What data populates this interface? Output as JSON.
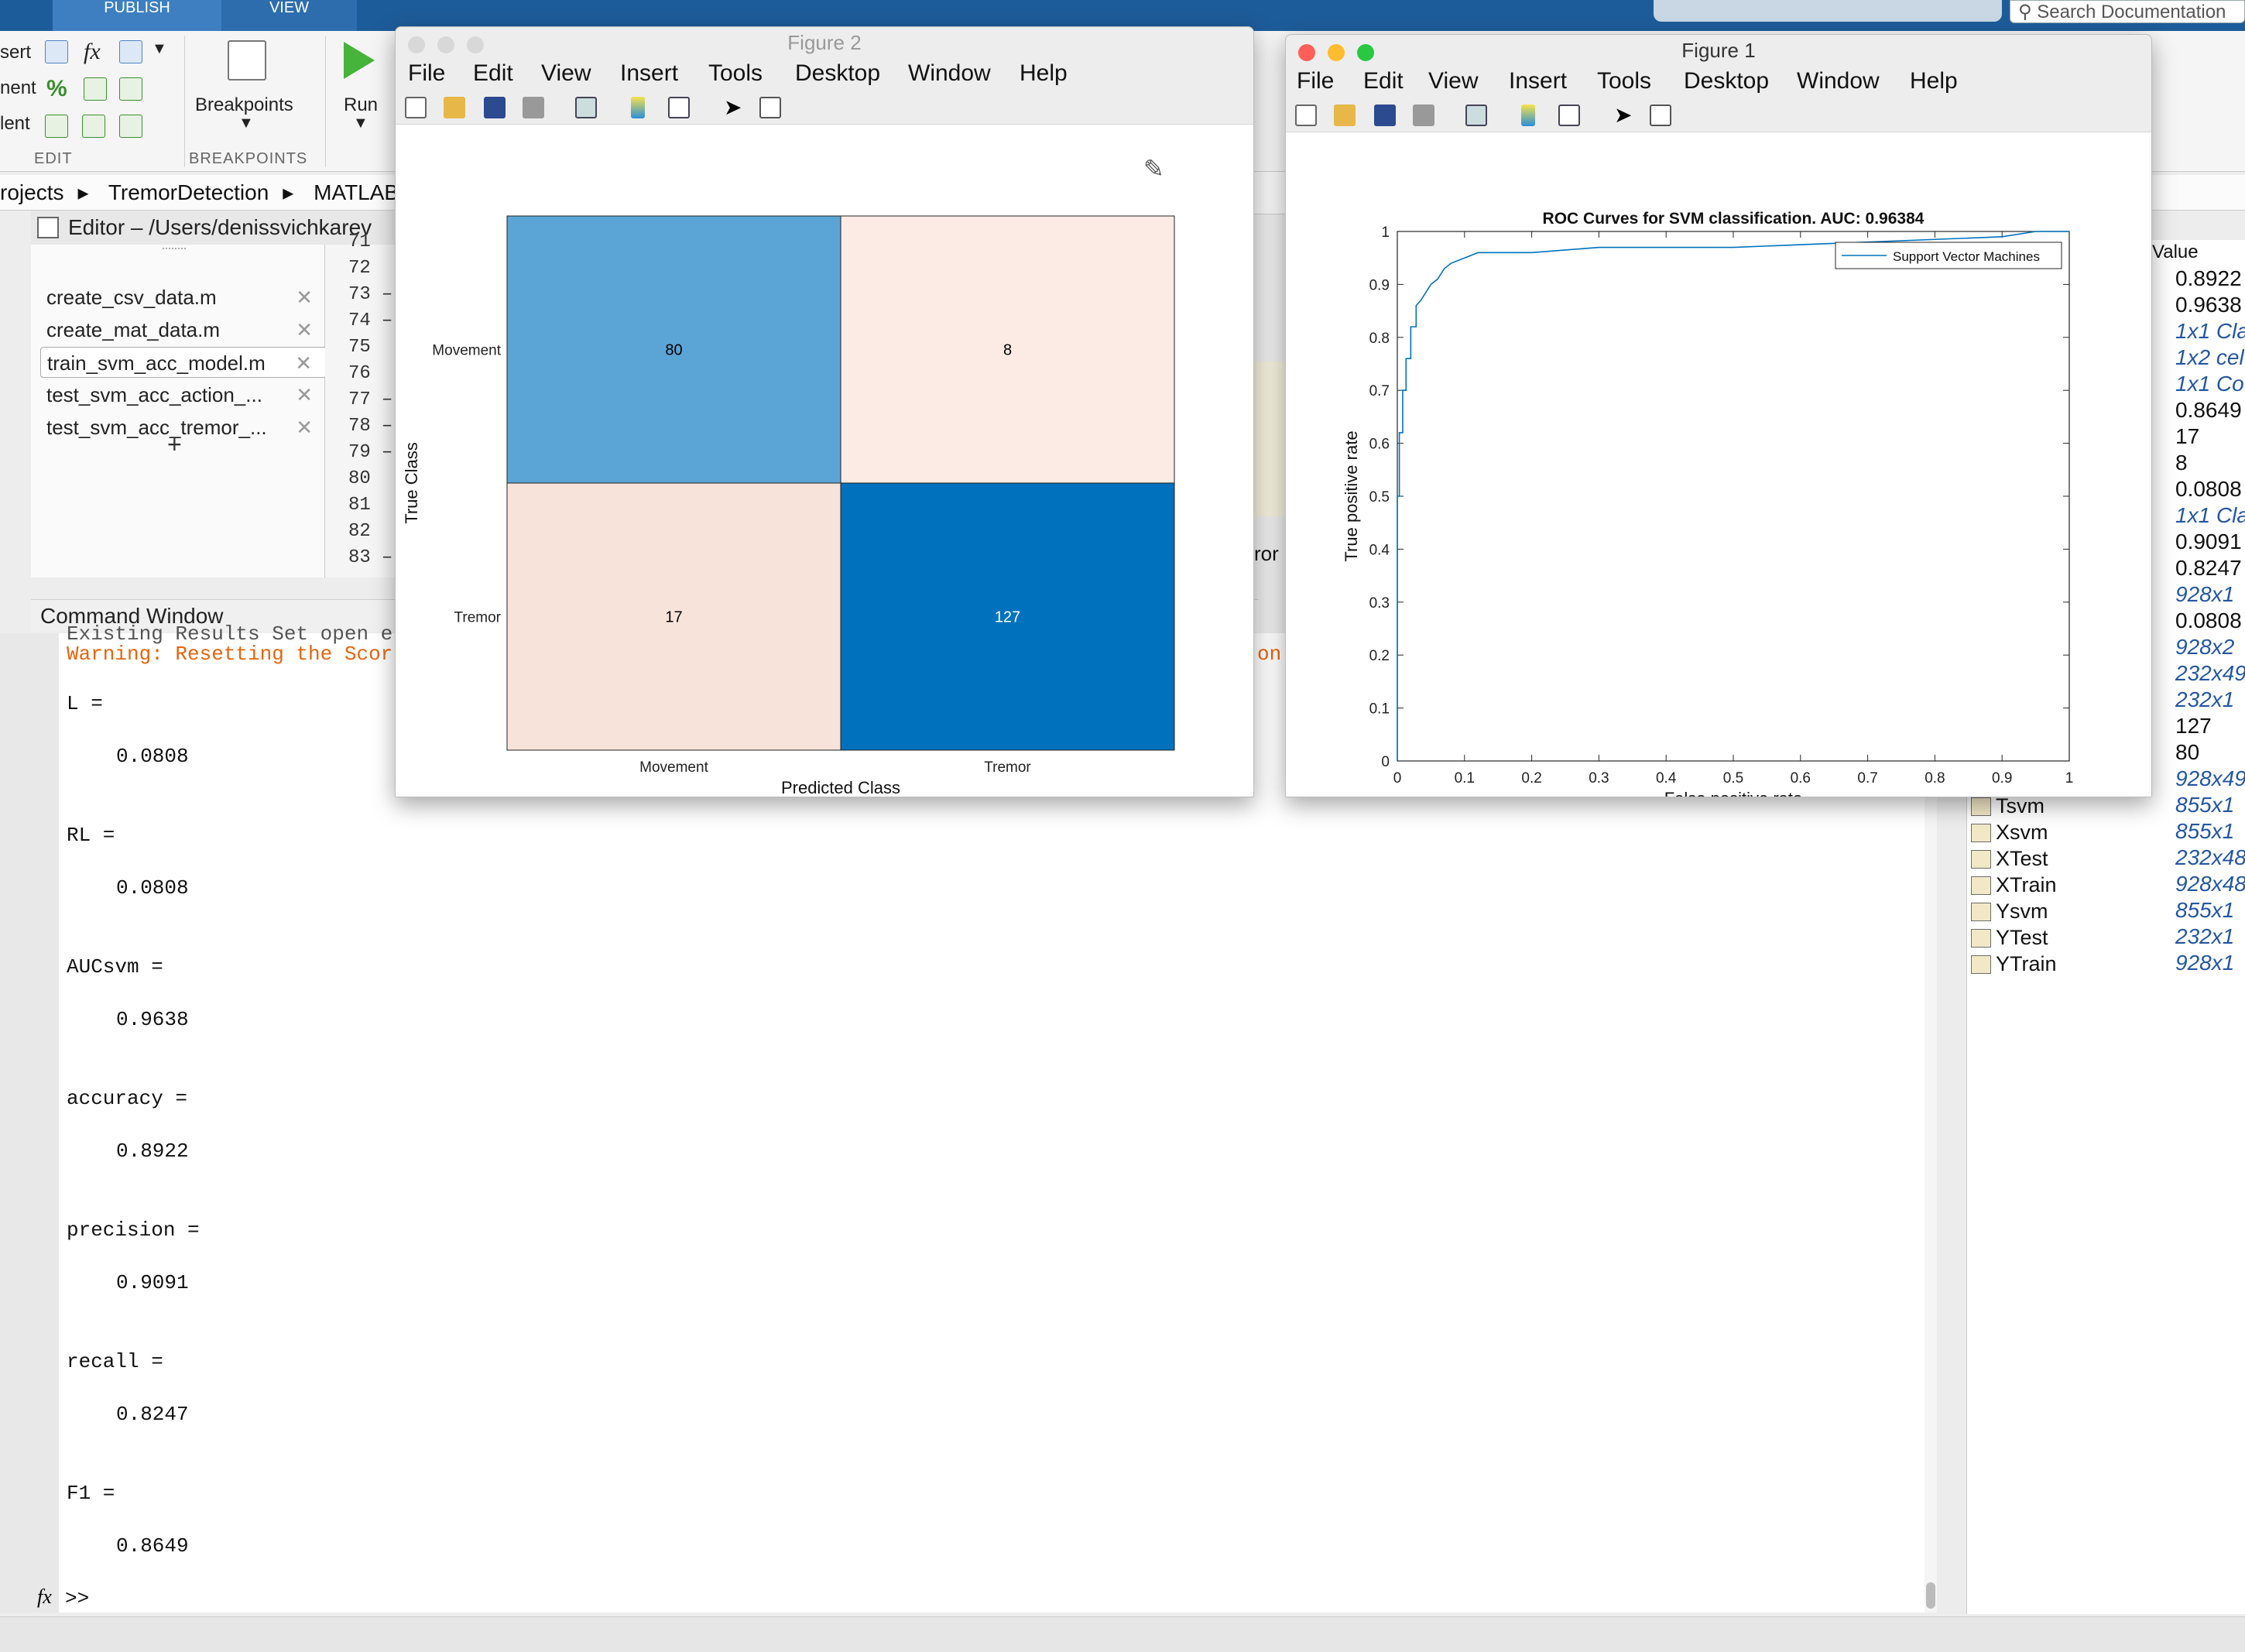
{
  "ribbon": {
    "tabs": [
      "PUBLISH",
      "VIEW"
    ],
    "search_placeholder": "Search Documentation",
    "edit_rows": [
      "sert",
      "nent",
      "lent"
    ],
    "fx_label": "fx",
    "percent_label": "%",
    "breakpoints_label": "Breakpoints",
    "run_label": "Run",
    "sections": [
      "EDIT",
      "BREAKPOINTS"
    ]
  },
  "breadcrumb": [
    "rojects",
    "TremorDetection",
    "MATLAB"
  ],
  "editor": {
    "title": "Editor – /Users/denissvichkarev",
    "files": [
      "create_csv_data.m",
      "create_mat_data.m",
      "train_svm_acc_model.m",
      "test_svm_acc_action_...",
      "test_svm_acc_tremor_..."
    ],
    "active_index": 2,
    "add_label": "+",
    "close_glyph": "✕",
    "line_numbers": [
      "71",
      "72",
      "73",
      "74",
      "75",
      "76",
      "77",
      "78",
      "79",
      "80",
      "81",
      "82",
      "83"
    ],
    "line_marks": [
      "",
      "",
      "–",
      "–",
      "",
      "",
      "–",
      "–",
      "–",
      "",
      "",
      "",
      "–"
    ],
    "code_fragment": "ror"
  },
  "command_window": {
    "title": "Command Window",
    "partial_line": "Existing Results Set open e",
    "warning": "Warning: Resetting the Scor",
    "warning_tail": "on.",
    "outputs": [
      {
        "name": "L =",
        "value": "0.0808"
      },
      {
        "name": "RL =",
        "value": "0.0808"
      },
      {
        "name": "AUCsvm =",
        "value": "0.9638"
      },
      {
        "name": "accuracy =",
        "value": "0.8922"
      },
      {
        "name": "precision =",
        "value": "0.9091"
      },
      {
        "name": "recall =",
        "value": "0.8247"
      },
      {
        "name": "F1 =",
        "value": "0.8649"
      }
    ],
    "prompt": ">>",
    "fx": "fx"
  },
  "workspace": {
    "header": "Value",
    "values": [
      "0.8922",
      "0.9638",
      "1x1 Cla",
      "1x2 cel",
      "1x1 Co",
      "0.8649",
      "17",
      "8",
      "0.0808",
      "1x1 Cla",
      "0.9091",
      "0.8247",
      "928x1",
      "0.0808",
      "928x2",
      "232x49",
      "232x1",
      "127",
      "80",
      "928x49",
      "855x1",
      "855x1",
      "232x48",
      "928x48",
      "855x1",
      "232x1",
      "928x1"
    ],
    "italic": [
      false,
      false,
      true,
      true,
      true,
      false,
      false,
      false,
      false,
      true,
      false,
      false,
      true,
      false,
      true,
      true,
      true,
      false,
      false,
      true,
      true,
      true,
      true,
      true,
      true,
      true,
      true
    ],
    "names": [
      "Tsvm",
      "Xsvm",
      "XTest",
      "XTrain",
      "Ysvm",
      "YTest",
      "YTrain"
    ]
  },
  "figure2": {
    "title": "Figure 2",
    "menu": [
      "File",
      "Edit",
      "View",
      "Insert",
      "Tools",
      "Desktop",
      "Window",
      "Help"
    ],
    "chart_data": {
      "type": "heatmap",
      "title": "",
      "xlabel": "Predicted Class",
      "ylabel": "True Class",
      "x_categories": [
        "Movement",
        "Tremor"
      ],
      "y_categories": [
        "Movement",
        "Tremor"
      ],
      "values": [
        [
          80,
          8
        ],
        [
          17,
          127
        ]
      ],
      "colors": [
        [
          "#5ba4d6",
          "#fbebe4"
        ],
        [
          "#f7e3da",
          "#0072bd"
        ]
      ],
      "text_colors": [
        [
          "#000000",
          "#000000"
        ],
        [
          "#000000",
          "#ffffff"
        ]
      ]
    }
  },
  "figure1": {
    "title": "Figure 1",
    "menu": [
      "File",
      "Edit",
      "View",
      "Insert",
      "Tools",
      "Desktop",
      "Window",
      "Help"
    ],
    "chart_data": {
      "type": "line",
      "title": "ROC Curves for SVM classification. AUC: 0.96384",
      "xlabel": "False positive rate",
      "ylabel": "True positive rate",
      "xlim": [
        0,
        1
      ],
      "ylim": [
        0,
        1
      ],
      "xticks": [
        "0",
        "0.1",
        "0.2",
        "0.3",
        "0.4",
        "0.5",
        "0.6",
        "0.7",
        "0.8",
        "0.9",
        "1"
      ],
      "yticks": [
        "0",
        "0.1",
        "0.2",
        "0.3",
        "0.4",
        "0.5",
        "0.6",
        "0.7",
        "0.8",
        "0.9",
        "1"
      ],
      "legend": "top-right",
      "series": [
        {
          "name": "Support Vector Machines",
          "color": "#0072bd",
          "x": [
            0,
            0,
            0.003,
            0.003,
            0.008,
            0.008,
            0.013,
            0.013,
            0.02,
            0.02,
            0.028,
            0.028,
            0.035,
            0.04,
            0.05,
            0.06,
            0.07,
            0.08,
            0.1,
            0.12,
            0.15,
            0.2,
            0.25,
            0.3,
            0.35,
            0.5,
            0.6,
            0.7,
            0.8,
            0.9,
            0.95,
            1
          ],
          "y": [
            0,
            0.5,
            0.5,
            0.62,
            0.62,
            0.7,
            0.7,
            0.76,
            0.76,
            0.82,
            0.82,
            0.86,
            0.87,
            0.88,
            0.9,
            0.91,
            0.93,
            0.94,
            0.95,
            0.96,
            0.96,
            0.96,
            0.965,
            0.97,
            0.97,
            0.97,
            0.975,
            0.98,
            0.985,
            0.99,
            1,
            1
          ]
        }
      ]
    }
  }
}
